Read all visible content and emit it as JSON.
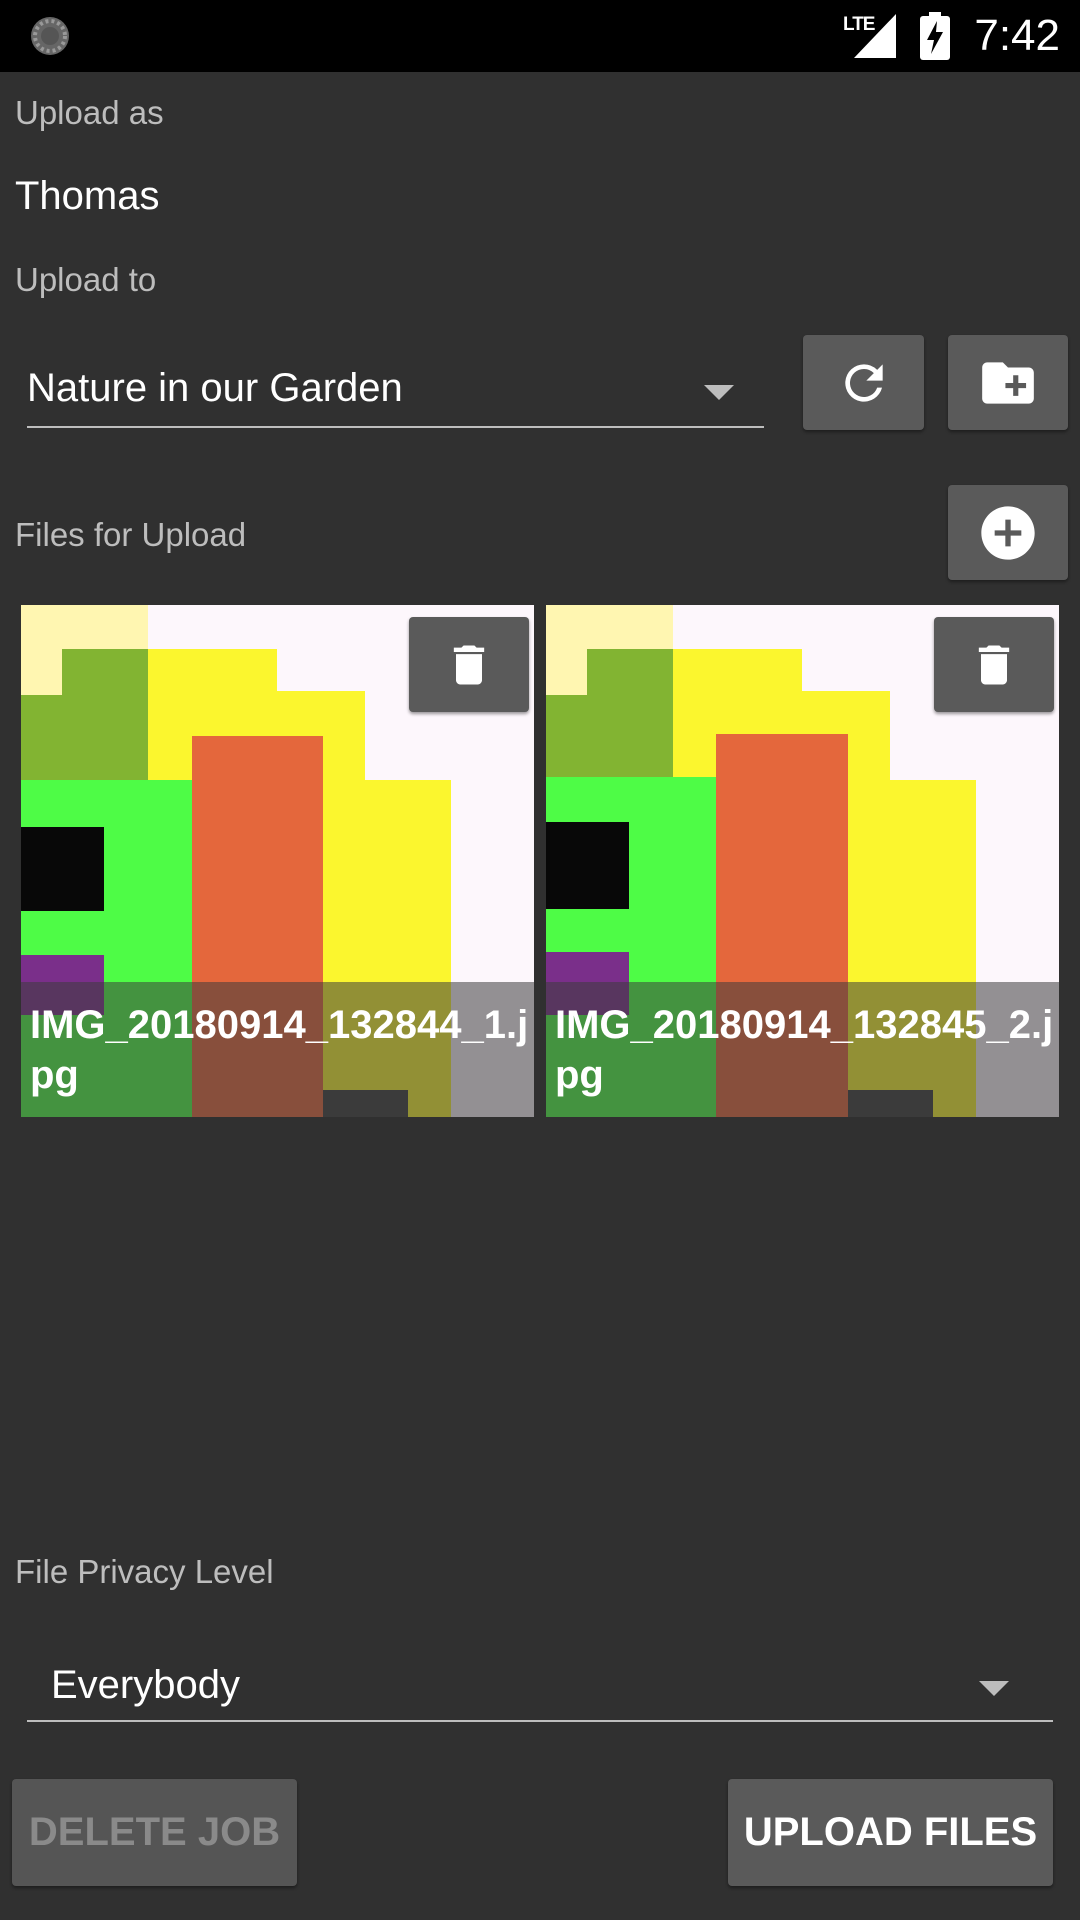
{
  "status_bar": {
    "time": "7:42",
    "network": "LTE"
  },
  "upload_as": {
    "label": "Upload as",
    "user": "Thomas"
  },
  "upload_to": {
    "label": "Upload to",
    "album": "Nature in our Garden"
  },
  "files": {
    "label": "Files for Upload",
    "items": [
      {
        "name": "IMG_20180914_132844_1.jpg"
      },
      {
        "name": "IMG_20180914_132845_2.jpg"
      }
    ]
  },
  "privacy": {
    "label": "File Privacy Level",
    "value": "Everybody"
  },
  "actions": {
    "delete_label": "DELETE JOB",
    "upload_label": "UPLOAD FILES"
  },
  "icons": {
    "refresh": "refresh-icon",
    "new_folder": "create-new-folder-icon",
    "add": "add-circle-icon",
    "delete": "trash-icon"
  }
}
